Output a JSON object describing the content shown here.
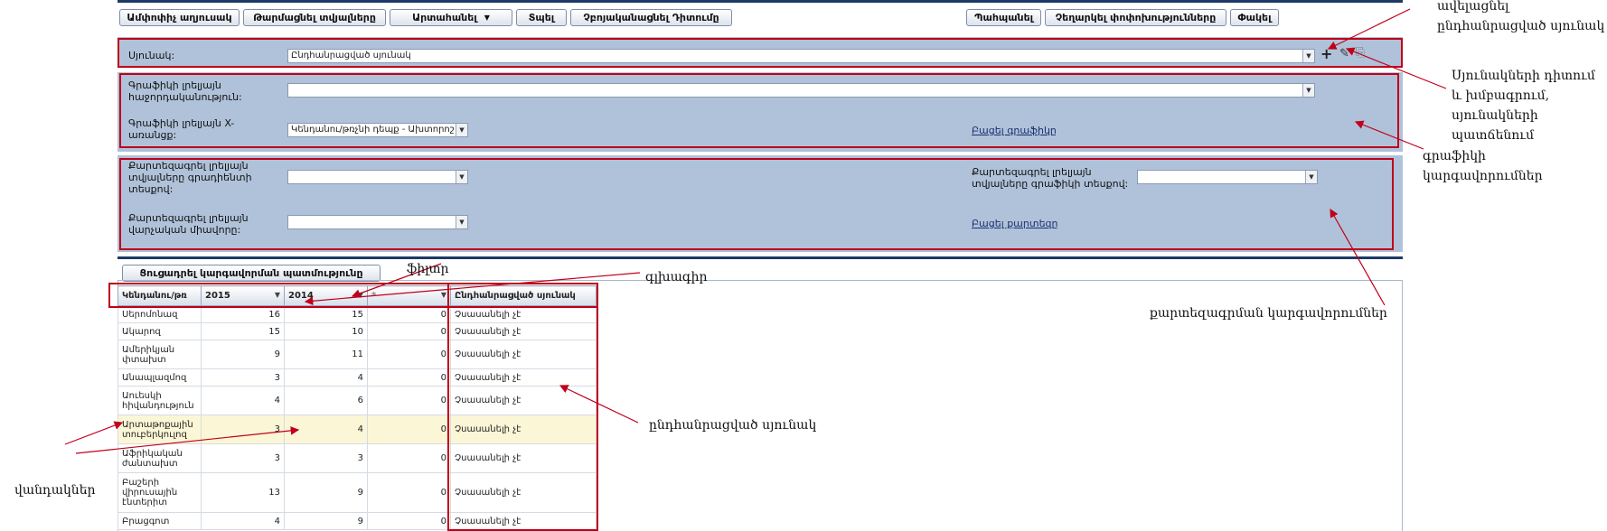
{
  "toolbar": {
    "left_buttons": [
      "Ամփոփիչ աղյուսակ",
      "Թարմացնել տվյալները",
      "Արտահանել",
      "Տպել",
      "Չբոյականացնել Դիտումը"
    ],
    "right_buttons": [
      "Պահպանել",
      "Չեղարկել փոփոխությունները",
      "Փակել"
    ]
  },
  "form": {
    "table_label": "Սյունակ:",
    "table_value": "Ընդհանրացված սյունակ",
    "graph_series_label": "Գրաֆիկի լրելյայն հաջորդականություն:",
    "graph_series_value": "",
    "graph_x_label": "Գրաֆիկի լրելյայն X-առանցք:",
    "graph_x_value": "Կենդանու/թռչնի դեպք - Ախտորոշ",
    "open_graph_link": "Բացել գրաֆիկը",
    "map_gradient_label": "Քարտեզագրել լրելյայն տվյալները գրադիենտի տեսքով:",
    "map_gradient_value": "",
    "map_graph_label": "Քարտեզագրել լրելյայն տվյալները գրաֆիկի տեսքով:",
    "map_graph_value": "",
    "map_unit_label": "Քարտեզագրել լրելյայն վարչական միավորը:",
    "map_unit_value": "",
    "open_map_link": "Բացել քարտեզը"
  },
  "history_button": "Ցուցադրել կարգավորման պատմությունը",
  "grid": {
    "headers": [
      "Կենդանու/թռ",
      "2015",
      "2014",
      "*",
      "Ընդհանրացված սյունակ"
    ],
    "rows": [
      [
        "Սերոմոնազ",
        "16",
        "15",
        "0",
        "Չսասանելի չէ"
      ],
      [
        "Ակարոզ",
        "15",
        "10",
        "0",
        "Չսասանելի չէ"
      ],
      [
        "Ամերիկյան փտախտ",
        "9",
        "11",
        "0",
        "Չսասանելի չէ"
      ],
      [
        "Անապլազմոզ",
        "3",
        "4",
        "0",
        "Չսասանելի չէ"
      ],
      [
        "Աուեսկի հիվանդություն",
        "4",
        "6",
        "0",
        "Չսասանելի չէ"
      ],
      [
        "Արտաթոքային տուբերկուլոզ",
        "3",
        "4",
        "0",
        "Չսասանելի չէ"
      ],
      [
        "Աֆրիկական ժանտախտ",
        "3",
        "3",
        "0",
        "Չսասանելի չէ"
      ],
      [
        "Բաշերի վիրուսային էնտերիտ",
        "13",
        "9",
        "0",
        "Չսասանելի չէ"
      ],
      [
        "Բրացգոտ",
        "4",
        "9",
        "0",
        "Չսասանելի չէ"
      ]
    ]
  },
  "annotations": {
    "add_column": "ավելացնել ընդհանրացված սյունակ",
    "column_view": "Սյունակների դիտում և խմբագրում, սյունակների պատճենում",
    "graph_settings": "գրաֆիկի կարգավորումներ",
    "filter": "ֆիլտր",
    "header": "գլխագիր",
    "map_settings": "քարտեզագրման կարգավորումներ",
    "computed_column": "ընդհանրացված սյունակ",
    "cells": "վանդակներ"
  },
  "colors": {
    "panel": "#b0c2d9",
    "annotation_red": "#c0001a",
    "highlight_row": "#fbf6d6"
  }
}
